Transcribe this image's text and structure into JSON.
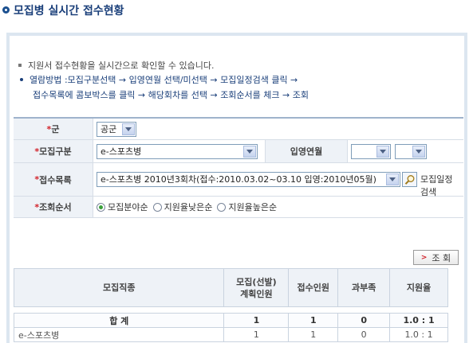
{
  "header": {
    "title": "모집병 실시간 접수현황"
  },
  "intro": {
    "note": "지원서 접수현황을 실시간으로 확인할 수 있습니다.",
    "how_line1": "열람방법 :모집구분선택 → 입영연월 선택/미선택 → 모집일정검색 클릭 →",
    "how_line2": "접수목록에 콤보박스를 클릭 → 해당회차를 선택 → 조회순서를 체크 → 조회"
  },
  "form": {
    "star": "*",
    "branch": {
      "label": "군",
      "value": "공군"
    },
    "category": {
      "label": "모집구분",
      "value": "e-스포츠병"
    },
    "enlist": {
      "label": "입영연월",
      "year": "",
      "month": ""
    },
    "list": {
      "label": "접수목록",
      "value": "e-스포츠병 2010년3회차(접수:2010.03.02~03.10 입영:2010년05월)",
      "search_label": "모집일정 검색"
    },
    "order": {
      "label": "조회순서",
      "options": [
        "모집분야순",
        "지원율낮은순",
        "지원율높은순"
      ],
      "selected": "모집분야순"
    }
  },
  "query_button": {
    "mark": ">",
    "label": "조 회"
  },
  "table": {
    "headers": [
      "모집직종",
      "모집(선발)\n계획인원",
      "접수인원",
      "과부족",
      "지원율"
    ],
    "total": [
      "합 계",
      "1",
      "1",
      "0",
      "1.0 : 1"
    ],
    "rows": [
      [
        "e-스포츠병",
        "1",
        "1",
        "0",
        "1.0 : 1"
      ]
    ]
  },
  "colors": {
    "accent": "#1a3f7a",
    "required": "#d2222a",
    "panel_border": "#dce6f0"
  }
}
